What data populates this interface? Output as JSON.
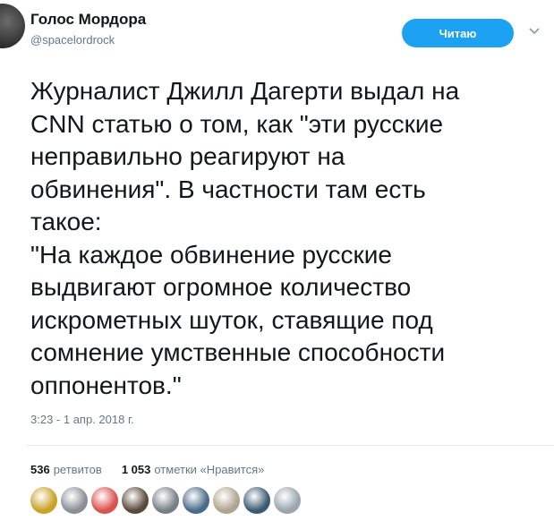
{
  "tweet": {
    "author_name": "Голос Мордора",
    "author_handle": "@spacelordrock",
    "follow_label": "Читаю",
    "text": "Журналист Джилл Дагерти выдал на\nCNN статью о том, как \"эти русские\nнеправильно реагируют на\nобвинения\". В частности там есть\nтакое:\n\"На каждое обвинение русские\nвыдвигают огромное количество\nискрометных шуток, ставящие под\nсомнение умственные способности\nоппонентов.\"",
    "timestamp": "3:23 - 1 апр. 2018 г."
  },
  "stats": {
    "retweets_count": "536",
    "retweets_label": "ретвитов",
    "likes_count": "1 053",
    "likes_label": "отметки «Нравится»"
  },
  "likers": [
    {
      "color": "#c9a227"
    },
    {
      "color": "#8a8f96"
    },
    {
      "color": "#d9534f"
    },
    {
      "color": "#5b4a3c"
    },
    {
      "color": "#7a7f86"
    },
    {
      "color": "#4b6b8a"
    },
    {
      "color": "#b0a48f"
    },
    {
      "color": "#3d5a73"
    },
    {
      "color": "#9aa5ad"
    }
  ]
}
